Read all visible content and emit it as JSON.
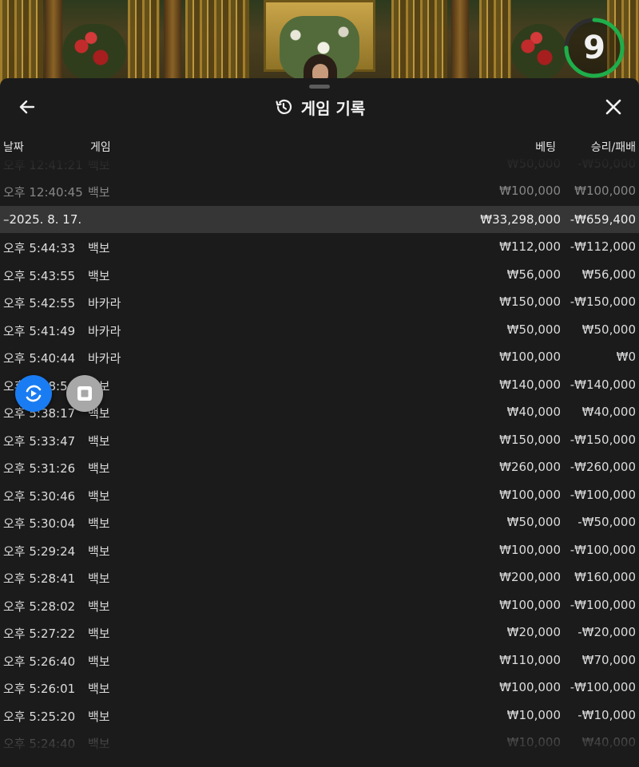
{
  "timer": {
    "value": "9",
    "remaining_fraction": 0.75,
    "color": "#1fae4a"
  },
  "header": {
    "title": "게임 기록",
    "back_icon": "arrow-left-icon",
    "history_icon": "history-icon",
    "close_icon": "close-icon"
  },
  "columns": {
    "date": "날짜",
    "game": "게임",
    "bet": "베팅",
    "result": "승리/패배"
  },
  "prev_day_rows": [
    {
      "time": "오후 12:41:21",
      "game": "백보",
      "bet": "₩50,000",
      "result": "-₩50,000"
    },
    {
      "time": "오후 12:40:45",
      "game": "백보",
      "bet": "₩100,000",
      "result": "₩100,000"
    }
  ],
  "day_group": {
    "date": "–2025. 8. 17.",
    "bet_total": "₩33,298,000",
    "result_total": "-₩659,400"
  },
  "rows": [
    {
      "time": "오후 5:44:33",
      "game": "백보",
      "bet": "₩112,000",
      "result": "-₩112,000"
    },
    {
      "time": "오후 5:43:55",
      "game": "백보",
      "bet": "₩56,000",
      "result": "₩56,000"
    },
    {
      "time": "오후 5:42:55",
      "game": "바카라",
      "bet": "₩150,000",
      "result": "-₩150,000"
    },
    {
      "time": "오후 5:41:49",
      "game": "바카라",
      "bet": "₩50,000",
      "result": "₩50,000"
    },
    {
      "time": "오후 5:40:44",
      "game": "바카라",
      "bet": "₩100,000",
      "result": "₩0"
    },
    {
      "time": "오후 5:38:5",
      "game": "백보",
      "bet": "₩140,000",
      "result": "-₩140,000"
    },
    {
      "time": "오후 5:38:17",
      "game": "백보",
      "bet": "₩40,000",
      "result": "₩40,000"
    },
    {
      "time": "오후 5:33:47",
      "game": "백보",
      "bet": "₩150,000",
      "result": "-₩150,000"
    },
    {
      "time": "오후 5:31:26",
      "game": "백보",
      "bet": "₩260,000",
      "result": "-₩260,000"
    },
    {
      "time": "오후 5:30:46",
      "game": "백보",
      "bet": "₩100,000",
      "result": "-₩100,000"
    },
    {
      "time": "오후 5:30:04",
      "game": "백보",
      "bet": "₩50,000",
      "result": "-₩50,000"
    },
    {
      "time": "오후 5:29:24",
      "game": "백보",
      "bet": "₩100,000",
      "result": "-₩100,000"
    },
    {
      "time": "오후 5:28:41",
      "game": "백보",
      "bet": "₩200,000",
      "result": "₩160,000"
    },
    {
      "time": "오후 5:28:02",
      "game": "백보",
      "bet": "₩100,000",
      "result": "-₩100,000"
    },
    {
      "time": "오후 5:27:22",
      "game": "백보",
      "bet": "₩20,000",
      "result": "-₩20,000"
    },
    {
      "time": "오후 5:26:40",
      "game": "백보",
      "bet": "₩110,000",
      "result": "₩70,000"
    },
    {
      "time": "오후 5:26:01",
      "game": "백보",
      "bet": "₩100,000",
      "result": "-₩100,000"
    },
    {
      "time": "오후 5:25:20",
      "game": "백보",
      "bet": "₩10,000",
      "result": "-₩10,000"
    },
    {
      "time": "오후 5:24:40",
      "game": "백보",
      "bet": "₩10,000",
      "result": "₩40,000"
    }
  ],
  "floating": {
    "record_icon": "screen-record-icon",
    "stop_icon": "stop-icon"
  },
  "colors": {
    "sheet_bg": "#1b1b1b",
    "date_row_bg": "#363636",
    "fab_blue": "#1a7cf2",
    "fab_gray": "#a8a8a8"
  }
}
